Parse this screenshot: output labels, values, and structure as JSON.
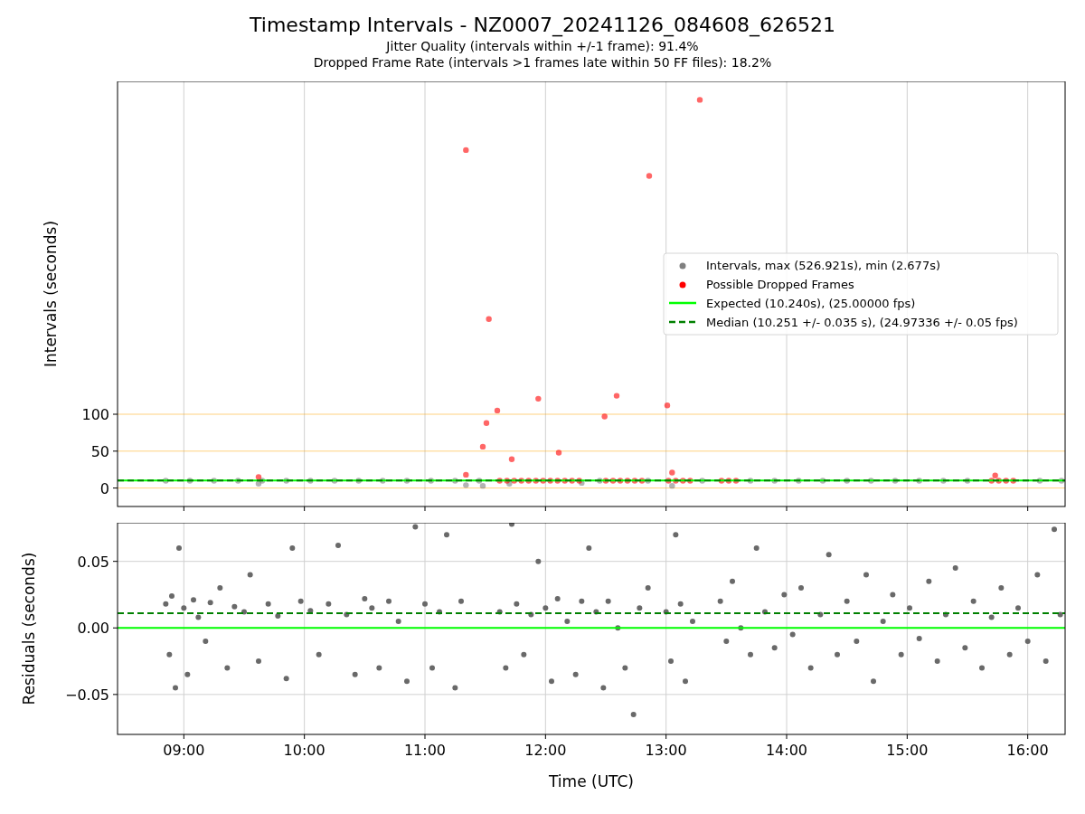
{
  "figure": {
    "title": "Timestamp Intervals - NZ0007_20241126_084608_626521",
    "subtitles": [
      "Jitter Quality (intervals within +/-1 frame): 91.4%",
      "Dropped Frame Rate (intervals >1 frames late within 50 FF files): 18.2%"
    ]
  },
  "intervals_panel": {
    "chart_data": {
      "type": "scatter",
      "ylabel": "Intervals (seconds)",
      "grid": true,
      "legend": "center right",
      "xlim": [
        8.45,
        16.31
      ],
      "ylim": [
        -25,
        551
      ],
      "yticks": [
        {
          "value": 0,
          "label": "0"
        },
        {
          "value": 50,
          "label": "50"
        },
        {
          "value": 100,
          "label": "100"
        }
      ],
      "series": [
        {
          "name": "Intervals, max (526.921s), min (2.677s)",
          "color": "#808080",
          "x": [
            8.85,
            9.05,
            9.25,
            9.45,
            9.62,
            9.65,
            9.85,
            10.05,
            10.25,
            10.45,
            10.65,
            10.85,
            11.05,
            11.25,
            11.34,
            11.45,
            11.48,
            11.7,
            12.3,
            12.45,
            12.85,
            13.05,
            13.3,
            13.7,
            13.9,
            14.1,
            14.3,
            14.5,
            14.7,
            14.9,
            15.1,
            15.3,
            15.5,
            16.1,
            16.28
          ],
          "values": [
            10,
            10,
            10,
            10,
            6,
            10,
            10,
            10,
            10,
            10,
            10,
            10,
            10,
            10,
            4,
            10,
            3,
            6,
            7,
            10,
            10,
            3,
            10,
            10,
            10,
            10,
            10,
            10,
            10,
            10,
            10,
            10,
            10,
            10,
            10
          ]
        },
        {
          "name": "Possible Dropped Frames",
          "color": "#ff0000",
          "x": [
            11.34,
            13.28,
            12.86,
            11.53,
            11.94,
            12.59,
            13.01,
            11.6,
            12.49,
            11.51,
            11.48,
            12.11,
            11.72,
            9.62,
            11.34,
            13.05,
            15.73,
            11.62,
            11.68,
            11.74,
            11.8,
            11.86,
            11.92,
            11.98,
            12.04,
            12.1,
            12.16,
            12.22,
            12.28,
            12.5,
            12.56,
            12.62,
            12.68,
            12.74,
            12.8,
            13.02,
            13.08,
            13.14,
            13.2,
            13.46,
            13.52,
            13.58,
            15.7,
            15.76,
            15.82,
            15.88
          ],
          "values": [
            458,
            526,
            423,
            229,
            121,
            125,
            112,
            105,
            97,
            88,
            56,
            48,
            39,
            15,
            18,
            21,
            17,
            10,
            10,
            10,
            10,
            10,
            10,
            10,
            10,
            10,
            10,
            10,
            10,
            10,
            10,
            10,
            10,
            10,
            10,
            10,
            10,
            10,
            10,
            10,
            10,
            10,
            10,
            10,
            10,
            10
          ]
        }
      ],
      "ref_lines": [
        {
          "axis": "y",
          "value": 0,
          "color": "#ffa500"
        },
        {
          "axis": "y",
          "value": 50,
          "color": "#ffa500"
        },
        {
          "axis": "y",
          "value": 100,
          "color": "#ffa500"
        },
        {
          "axis": "y",
          "value": 10.24,
          "label": "Expected (10.240s), (25.00000 fps)",
          "color": "#00ff00"
        },
        {
          "axis": "y",
          "value": 10.251,
          "label": "Median (10.251 +/- 0.035 s), (24.97336 +/- 0.05 fps)",
          "color": "#008000"
        }
      ]
    }
  },
  "residuals_panel": {
    "chart_data": {
      "type": "scatter",
      "xlabel": "Time (UTC)",
      "ylabel": "Residuals (seconds)",
      "grid": true,
      "xlim": [
        8.45,
        16.31
      ],
      "xticks": [
        {
          "value": 9,
          "label": "09:00"
        },
        {
          "value": 10,
          "label": "10:00"
        },
        {
          "value": 11,
          "label": "11:00"
        },
        {
          "value": 12,
          "label": "12:00"
        },
        {
          "value": 13,
          "label": "13:00"
        },
        {
          "value": 14,
          "label": "14:00"
        },
        {
          "value": 15,
          "label": "15:00"
        },
        {
          "value": 16,
          "label": "16:00"
        }
      ],
      "ylim": [
        -0.08,
        0.079
      ],
      "yticks": [
        {
          "value": 0.05,
          "label": "0.05"
        },
        {
          "value": 0,
          "label": "0.00"
        },
        {
          "value": -0.05,
          "label": "−0.05"
        }
      ],
      "series": [
        {
          "color": "#696969",
          "x": [
            8.85,
            8.88,
            8.9,
            8.93,
            8.96,
            9.0,
            9.03,
            9.08,
            9.12,
            9.18,
            9.22,
            9.3,
            9.36,
            9.42,
            9.5,
            9.55,
            9.62,
            9.7,
            9.78,
            9.85,
            9.9,
            9.97,
            10.05,
            10.12,
            10.2,
            10.28,
            10.35,
            10.42,
            10.5,
            10.56,
            10.62,
            10.7,
            10.78,
            10.85,
            10.92,
            11.0,
            11.06,
            11.12,
            11.18,
            11.25,
            11.3,
            11.62,
            11.67,
            11.72,
            11.76,
            11.82,
            11.88,
            11.94,
            12.0,
            12.05,
            12.1,
            12.18,
            12.25,
            12.3,
            12.36,
            12.42,
            12.48,
            12.52,
            12.6,
            12.66,
            12.73,
            12.78,
            12.85,
            13.0,
            13.04,
            13.08,
            13.12,
            13.16,
            13.22,
            13.45,
            13.5,
            13.55,
            13.62,
            13.7,
            13.75,
            13.82,
            13.9,
            13.98,
            14.05,
            14.12,
            14.2,
            14.28,
            14.35,
            14.42,
            14.5,
            14.58,
            14.66,
            14.72,
            14.8,
            14.88,
            14.95,
            15.02,
            15.1,
            15.18,
            15.25,
            15.32,
            15.4,
            15.48,
            15.55,
            15.62,
            15.7,
            15.78,
            15.85,
            15.92,
            16.0,
            16.08,
            16.15,
            16.22,
            16.27
          ],
          "values": [
            0.018,
            -0.02,
            0.024,
            -0.045,
            0.06,
            0.015,
            -0.035,
            0.021,
            0.008,
            -0.01,
            0.019,
            0.03,
            -0.03,
            0.016,
            0.012,
            0.04,
            -0.025,
            0.018,
            0.009,
            -0.038,
            0.06,
            0.02,
            0.013,
            -0.02,
            0.018,
            0.062,
            0.01,
            -0.035,
            0.022,
            0.015,
            -0.03,
            0.02,
            0.005,
            -0.04,
            0.076,
            0.018,
            -0.03,
            0.012,
            0.07,
            -0.045,
            0.02,
            0.012,
            -0.03,
            0.078,
            0.018,
            -0.02,
            0.01,
            0.05,
            0.015,
            -0.04,
            0.022,
            0.005,
            -0.035,
            0.02,
            0.06,
            0.012,
            -0.045,
            0.02,
            0.0,
            -0.03,
            -0.065,
            0.015,
            0.03,
            0.012,
            -0.025,
            0.07,
            0.018,
            -0.04,
            0.005,
            0.02,
            -0.01,
            0.035,
            0.0,
            -0.02,
            0.06,
            0.012,
            -0.015,
            0.025,
            -0.005,
            0.03,
            -0.03,
            0.01,
            0.055,
            -0.02,
            0.02,
            -0.01,
            0.04,
            -0.04,
            0.005,
            0.025,
            -0.02,
            0.015,
            -0.008,
            0.035,
            -0.025,
            0.01,
            0.045,
            -0.015,
            0.02,
            -0.03,
            0.008,
            0.03,
            -0.02,
            0.015,
            -0.01,
            0.04,
            -0.025,
            0.074,
            0.01
          ]
        }
      ],
      "ref_lines": [
        {
          "axis": "y",
          "value": 0,
          "color": "#00ff00"
        },
        {
          "axis": "y",
          "value": 0.011,
          "color": "#008000"
        }
      ]
    }
  }
}
